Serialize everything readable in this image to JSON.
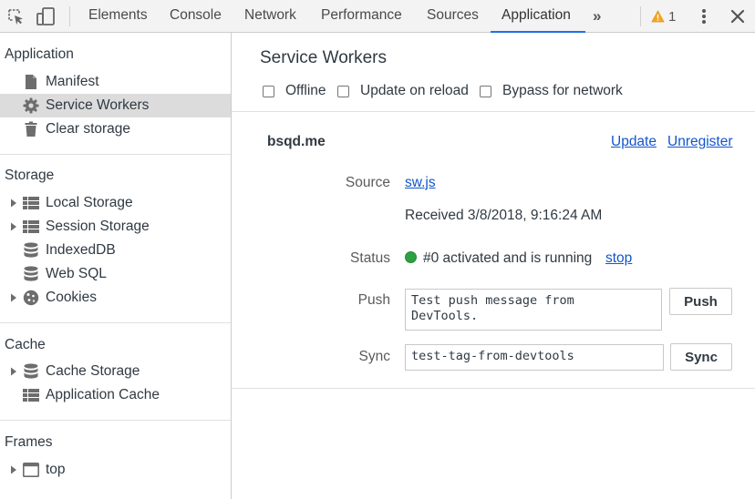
{
  "toolbar": {
    "tabs": [
      "Elements",
      "Console",
      "Network",
      "Performance",
      "Sources",
      "Application"
    ],
    "active_tab": "Application",
    "more_label": "»",
    "warning_count": "1",
    "icons": [
      "inspect-element-icon",
      "device-toolbar-icon",
      "warning-icon",
      "kebab-menu-icon",
      "close-icon"
    ]
  },
  "sidebar": {
    "application_title": "Application",
    "application_items": [
      "Manifest",
      "Service Workers",
      "Clear storage"
    ],
    "selected_item": "Service Workers",
    "storage_title": "Storage",
    "storage_items": [
      "Local Storage",
      "Session Storage",
      "IndexedDB",
      "Web SQL",
      "Cookies"
    ],
    "cache_title": "Cache",
    "cache_items": [
      "Cache Storage",
      "Application Cache"
    ],
    "frames_title": "Frames",
    "frames_items": [
      "top"
    ]
  },
  "main": {
    "title": "Service Workers",
    "checkboxes": [
      {
        "label": "Offline",
        "checked": false
      },
      {
        "label": "Update on reload",
        "checked": false
      },
      {
        "label": "Bypass for network",
        "checked": false
      }
    ],
    "worker": {
      "origin": "bsqd.me",
      "update_label": "Update",
      "unregister_label": "Unregister",
      "source_label": "Source",
      "source_file": "sw.js",
      "received": "Received 3/8/2018, 9:16:24 AM",
      "status_label": "Status",
      "status_text": "#0 activated and is running",
      "status_color": "#2ea043",
      "stop_label": "stop",
      "push_label": "Push",
      "push_value": "Test push message from\nDevTools.",
      "push_button": "Push",
      "sync_label": "Sync",
      "sync_value": "test-tag-from-devtools",
      "sync_button": "Sync"
    }
  },
  "colors": {
    "accent": "#1a73e8",
    "link": "#1155cc",
    "warning": "#f5a623",
    "selected_bg": "#dcdcdc"
  }
}
